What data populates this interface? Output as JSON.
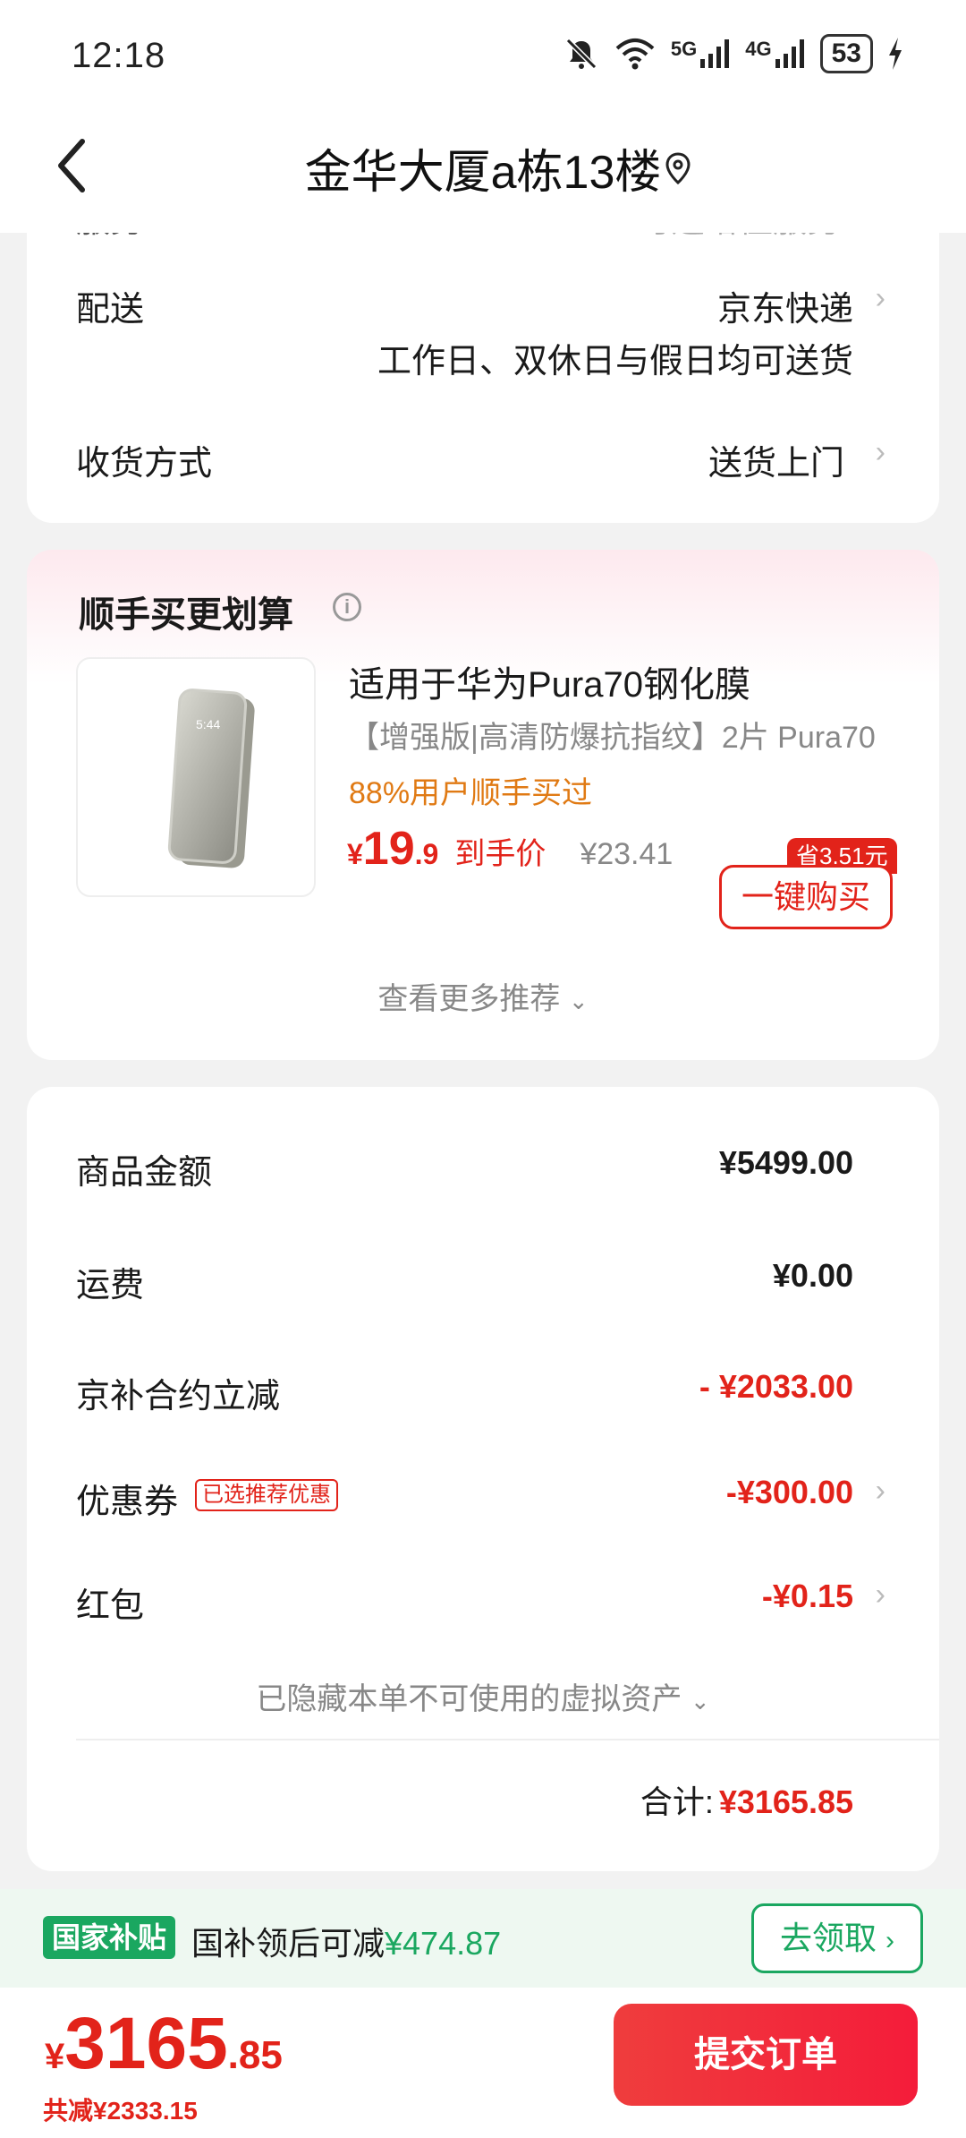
{
  "status_bar": {
    "time": "12:18",
    "network_5g": "5G",
    "network_4g": "4G",
    "battery": "53"
  },
  "header": {
    "title": "金华大厦a栋13楼"
  },
  "delivery_card": {
    "cutoff_label": "服务",
    "cutoff_value": "可选增值服务",
    "delivery_label": "配送",
    "delivery_value": "京东快递",
    "delivery_note": "工作日、双休日与假日均可送货",
    "receive_label": "收货方式",
    "receive_value": "送货上门"
  },
  "upsell": {
    "title": "顺手买更划算",
    "product_name": "适用于华为Pura70钢化膜",
    "product_desc": "【增强版|高清防爆抗指纹】2片  Pura70",
    "product_stat": "88%用户顺手买过",
    "price_symbol": "¥",
    "price_int": "19",
    "price_dec": ".9",
    "price_label": "到手价",
    "original_price": "¥23.41",
    "save_tag": "省3.51元",
    "buy_label": "一键购买",
    "more_label": "查看更多推荐",
    "phone_time": "5:44"
  },
  "summary": {
    "items": [
      {
        "label": "商品金额",
        "value": "¥5499.00"
      },
      {
        "label": "运费",
        "value": "¥0.00"
      },
      {
        "label": "京补合约立减",
        "value": "- ¥2033.00"
      },
      {
        "label": "优惠券",
        "tag": "已选推荐优惠",
        "value": "-¥300.00"
      },
      {
        "label": "红包",
        "value": "-¥0.15"
      }
    ],
    "hidden_assets": "已隐藏本单不可使用的虚拟资产",
    "total_label": "合计:",
    "total_value": "¥3165.85"
  },
  "subsidy": {
    "tag": "国家补贴",
    "text": "国补领后可减",
    "amount": "¥474.87",
    "claim": "去领取"
  },
  "footer": {
    "currency": "¥",
    "total_int": "3165",
    "total_dec": ".85",
    "saved": "共减¥2333.15",
    "submit": "提交订单"
  },
  "colors": {
    "accent_red": "#e2231a",
    "subsidy_green": "#1aa760",
    "stat_orange": "#e07a14"
  }
}
